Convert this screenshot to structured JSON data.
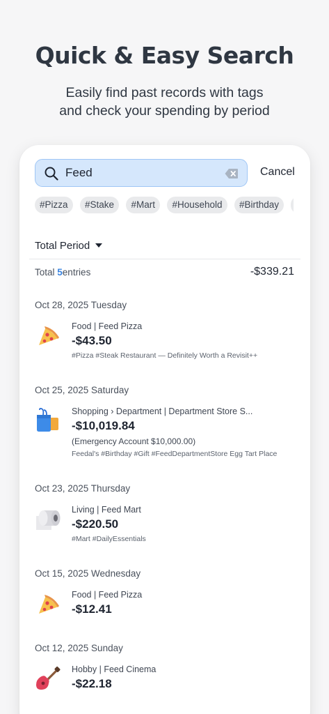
{
  "hero": {
    "title": "Quick & Easy Search",
    "subtitle_line1": "Easily find past records with tags",
    "subtitle_line2": "and check your spending by period"
  },
  "search": {
    "query": "Feed",
    "cancel_label": "Cancel",
    "icons": {
      "search": "search-icon",
      "clear": "clear-icon"
    }
  },
  "tags": [
    "#Pizza",
    "#Stake",
    "#Mart",
    "#Household",
    "#Birthday",
    "#"
  ],
  "period": {
    "label": "Total Period",
    "icon": "caret-down-icon"
  },
  "summary": {
    "prefix": "Total ",
    "count": "5",
    "suffix": "entries",
    "amount": "-$339.21"
  },
  "days": [
    {
      "date": "Oct 28, 2025 Tuesday",
      "entry": {
        "icon": "pizza-icon",
        "category": "Food | Feed Pizza",
        "amount": "-$43.50",
        "tags": "#Pizza #Steak Restaurant — Definitely Worth a Revisit++"
      }
    },
    {
      "date": "Oct 25, 2025 Saturday",
      "entry": {
        "icon": "shopping-bag-icon",
        "category": "Shopping › Department | Department Store S...",
        "amount": "-$10,019.84",
        "extra": "(Emergency Account $10,000.00)",
        "tags": "Feedal's #Birthday #Gift #FeedDepartmentStore Egg Tart Place"
      }
    },
    {
      "date": "Oct 23, 2025 Thursday",
      "entry": {
        "icon": "toilet-paper-icon",
        "category": "Living | Feed Mart",
        "amount": "-$220.50",
        "tags": "#Mart #DailyEssentials"
      }
    },
    {
      "date": "Oct 15, 2025 Wednesday",
      "entry": {
        "icon": "pizza-icon",
        "category": "Food | Feed Pizza",
        "amount": "-$12.41"
      }
    },
    {
      "date": "Oct 12, 2025 Sunday",
      "entry": {
        "icon": "guitar-icon",
        "category": "Hobby | Feed Cinema",
        "amount": "-$22.18"
      }
    }
  ]
}
